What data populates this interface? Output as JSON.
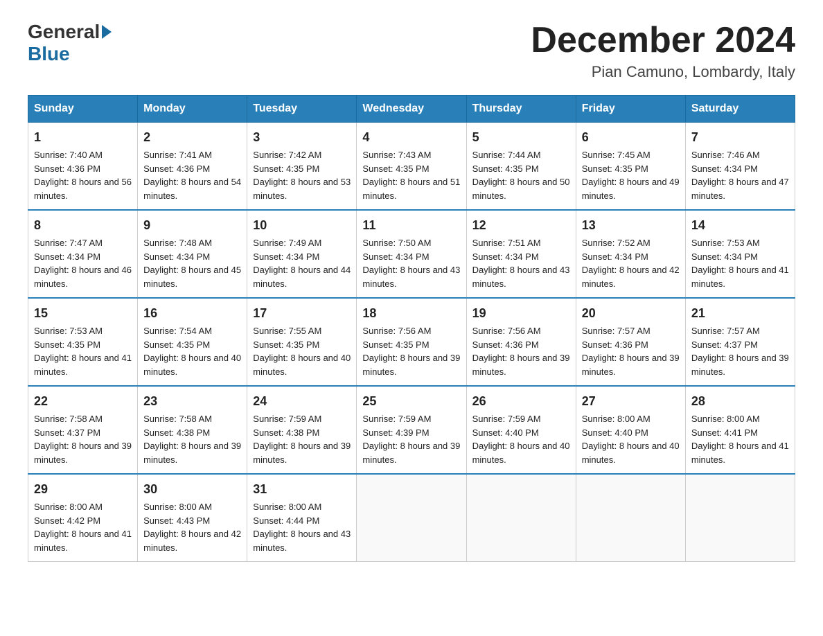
{
  "header": {
    "logo_general": "General",
    "logo_blue": "Blue",
    "month_title": "December 2024",
    "location": "Pian Camuno, Lombardy, Italy"
  },
  "days_of_week": [
    "Sunday",
    "Monday",
    "Tuesday",
    "Wednesday",
    "Thursday",
    "Friday",
    "Saturday"
  ],
  "weeks": [
    [
      {
        "day": 1,
        "sunrise": "7:40 AM",
        "sunset": "4:36 PM",
        "daylight": "8 hours and 56 minutes."
      },
      {
        "day": 2,
        "sunrise": "7:41 AM",
        "sunset": "4:36 PM",
        "daylight": "8 hours and 54 minutes."
      },
      {
        "day": 3,
        "sunrise": "7:42 AM",
        "sunset": "4:35 PM",
        "daylight": "8 hours and 53 minutes."
      },
      {
        "day": 4,
        "sunrise": "7:43 AM",
        "sunset": "4:35 PM",
        "daylight": "8 hours and 51 minutes."
      },
      {
        "day": 5,
        "sunrise": "7:44 AM",
        "sunset": "4:35 PM",
        "daylight": "8 hours and 50 minutes."
      },
      {
        "day": 6,
        "sunrise": "7:45 AM",
        "sunset": "4:35 PM",
        "daylight": "8 hours and 49 minutes."
      },
      {
        "day": 7,
        "sunrise": "7:46 AM",
        "sunset": "4:34 PM",
        "daylight": "8 hours and 47 minutes."
      }
    ],
    [
      {
        "day": 8,
        "sunrise": "7:47 AM",
        "sunset": "4:34 PM",
        "daylight": "8 hours and 46 minutes."
      },
      {
        "day": 9,
        "sunrise": "7:48 AM",
        "sunset": "4:34 PM",
        "daylight": "8 hours and 45 minutes."
      },
      {
        "day": 10,
        "sunrise": "7:49 AM",
        "sunset": "4:34 PM",
        "daylight": "8 hours and 44 minutes."
      },
      {
        "day": 11,
        "sunrise": "7:50 AM",
        "sunset": "4:34 PM",
        "daylight": "8 hours and 43 minutes."
      },
      {
        "day": 12,
        "sunrise": "7:51 AM",
        "sunset": "4:34 PM",
        "daylight": "8 hours and 43 minutes."
      },
      {
        "day": 13,
        "sunrise": "7:52 AM",
        "sunset": "4:34 PM",
        "daylight": "8 hours and 42 minutes."
      },
      {
        "day": 14,
        "sunrise": "7:53 AM",
        "sunset": "4:34 PM",
        "daylight": "8 hours and 41 minutes."
      }
    ],
    [
      {
        "day": 15,
        "sunrise": "7:53 AM",
        "sunset": "4:35 PM",
        "daylight": "8 hours and 41 minutes."
      },
      {
        "day": 16,
        "sunrise": "7:54 AM",
        "sunset": "4:35 PM",
        "daylight": "8 hours and 40 minutes."
      },
      {
        "day": 17,
        "sunrise": "7:55 AM",
        "sunset": "4:35 PM",
        "daylight": "8 hours and 40 minutes."
      },
      {
        "day": 18,
        "sunrise": "7:56 AM",
        "sunset": "4:35 PM",
        "daylight": "8 hours and 39 minutes."
      },
      {
        "day": 19,
        "sunrise": "7:56 AM",
        "sunset": "4:36 PM",
        "daylight": "8 hours and 39 minutes."
      },
      {
        "day": 20,
        "sunrise": "7:57 AM",
        "sunset": "4:36 PM",
        "daylight": "8 hours and 39 minutes."
      },
      {
        "day": 21,
        "sunrise": "7:57 AM",
        "sunset": "4:37 PM",
        "daylight": "8 hours and 39 minutes."
      }
    ],
    [
      {
        "day": 22,
        "sunrise": "7:58 AM",
        "sunset": "4:37 PM",
        "daylight": "8 hours and 39 minutes."
      },
      {
        "day": 23,
        "sunrise": "7:58 AM",
        "sunset": "4:38 PM",
        "daylight": "8 hours and 39 minutes."
      },
      {
        "day": 24,
        "sunrise": "7:59 AM",
        "sunset": "4:38 PM",
        "daylight": "8 hours and 39 minutes."
      },
      {
        "day": 25,
        "sunrise": "7:59 AM",
        "sunset": "4:39 PM",
        "daylight": "8 hours and 39 minutes."
      },
      {
        "day": 26,
        "sunrise": "7:59 AM",
        "sunset": "4:40 PM",
        "daylight": "8 hours and 40 minutes."
      },
      {
        "day": 27,
        "sunrise": "8:00 AM",
        "sunset": "4:40 PM",
        "daylight": "8 hours and 40 minutes."
      },
      {
        "day": 28,
        "sunrise": "8:00 AM",
        "sunset": "4:41 PM",
        "daylight": "8 hours and 41 minutes."
      }
    ],
    [
      {
        "day": 29,
        "sunrise": "8:00 AM",
        "sunset": "4:42 PM",
        "daylight": "8 hours and 41 minutes."
      },
      {
        "day": 30,
        "sunrise": "8:00 AM",
        "sunset": "4:43 PM",
        "daylight": "8 hours and 42 minutes."
      },
      {
        "day": 31,
        "sunrise": "8:00 AM",
        "sunset": "4:44 PM",
        "daylight": "8 hours and 43 minutes."
      },
      null,
      null,
      null,
      null
    ]
  ]
}
